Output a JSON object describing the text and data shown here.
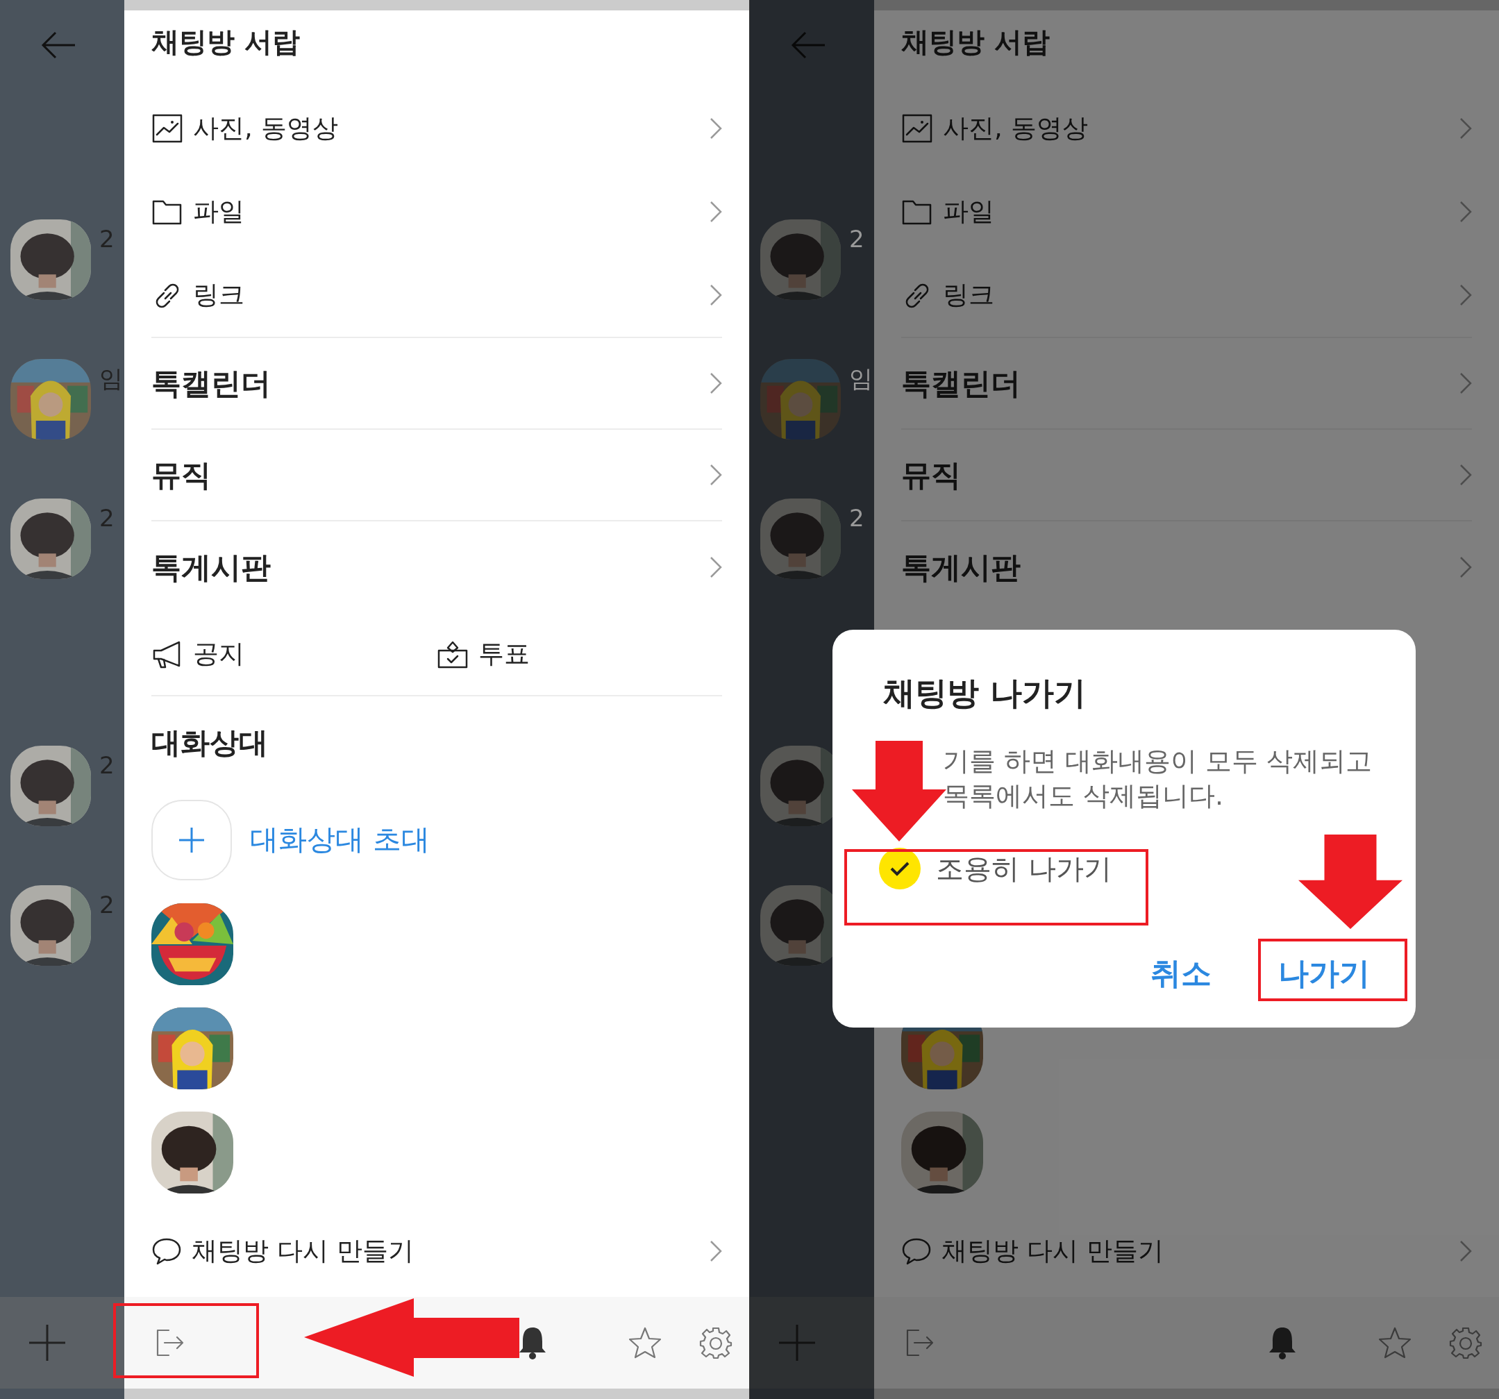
{
  "panels": [
    {
      "dimmed": false,
      "strip": {
        "items": [
          {
            "label": "2"
          },
          {
            "label": "임"
          },
          {
            "label": "2"
          },
          {
            "label": "2"
          },
          {
            "label": "2"
          }
        ]
      },
      "drawer": {
        "title": "채팅방 서랍",
        "media_items": [
          {
            "label": "사진, 동영상"
          },
          {
            "label": "파일"
          },
          {
            "label": "링크"
          }
        ],
        "sections": [
          "톡캘린더",
          "뮤직",
          "톡게시판"
        ],
        "shortcuts": [
          {
            "label": "공지"
          },
          {
            "label": "투표"
          }
        ],
        "members_heading": "대화상대",
        "invite_label": "대화상대 초대",
        "remake_label": "채팅방 다시 만들기"
      }
    },
    {
      "dimmed": true,
      "strip": {
        "items": [
          {
            "label": "2"
          },
          {
            "label": "임"
          },
          {
            "label": "2"
          }
        ]
      },
      "drawer": {
        "title": "채팅방 서랍",
        "media_items": [
          {
            "label": "사진, 동영상"
          },
          {
            "label": "파일"
          },
          {
            "label": "링크"
          }
        ],
        "sections": [
          "톡캘린더",
          "뮤직",
          "톡게시판"
        ],
        "remake_label": "채팅방 다시 만들기"
      },
      "dialog": {
        "title": "채팅방 나가기",
        "body_lines": [
          "기를 하면 대화내용이 모두 삭제되고",
          "목록에서도 삭제됩니다."
        ],
        "option": {
          "label": "조용히 나가기",
          "checked": true
        },
        "buttons": [
          {
            "label": "취소",
            "kind": "cancel"
          },
          {
            "label": "나가기",
            "kind": "confirm"
          }
        ]
      }
    }
  ]
}
